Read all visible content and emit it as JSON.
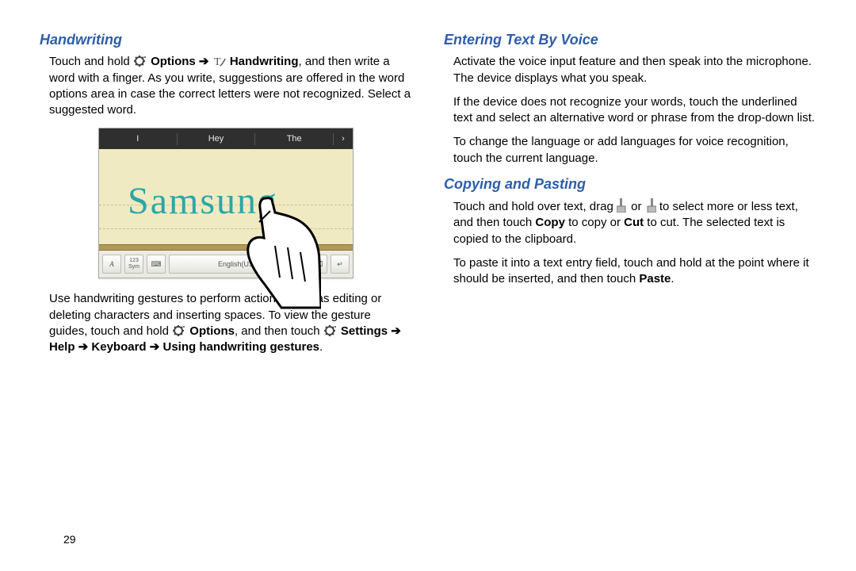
{
  "page_number": "29",
  "left": {
    "heading": "Handwriting",
    "p1_a": "Touch and hold ",
    "p1_b": " Options ➔ ",
    "p1_c": " Handwriting",
    "p1_d": ", and then write a word with a finger. As you write, suggestions are offered in the word options area in case the correct letters were not recognized. Select a suggested word.",
    "demo": {
      "sugg1": "I",
      "sugg2": "Hey",
      "sugg3": "The",
      "chev": "›",
      "handwritten": "Samsung",
      "key_a": "A",
      "key_sym": "123\nSym",
      "key_grid": "⌨",
      "key_lang": "English(US)",
      "key_enter": "↵",
      "key_back": "⌫"
    },
    "p2_a": "Use handwriting gestures to perform actions, such as editing or deleting characters and inserting spaces. To view the gesture guides, touch and hold ",
    "p2_b": " Options",
    "p2_c": ", and then touch ",
    "p2_d": " Settings ➔ Help ➔ Keyboard ➔ Using handwriting gestures",
    "p2_e": "."
  },
  "right": {
    "heading1": "Entering Text By Voice",
    "v_p1": "Activate the voice input feature and then speak into the microphone. The device displays what you speak.",
    "v_p2": "If the device does not recognize your words, touch the underlined text and select an alternative word or phrase from the drop-down list.",
    "v_p3": "To change the language or add languages for voice recognition, touch the current language.",
    "heading2": "Copying and Pasting",
    "c_p1_a": "Touch and hold over text, drag ",
    "c_p1_b": " or ",
    "c_p1_c": " to select more or less text, and then touch ",
    "c_p1_copy": "Copy",
    "c_p1_d": " to copy or ",
    "c_p1_cut": "Cut",
    "c_p1_e": " to cut. The selected text is copied to the clipboard.",
    "c_p2_a": "To paste it into a text entry field, touch and hold at the point where it should be inserted, and then touch ",
    "c_p2_paste": "Paste",
    "c_p2_b": "."
  }
}
